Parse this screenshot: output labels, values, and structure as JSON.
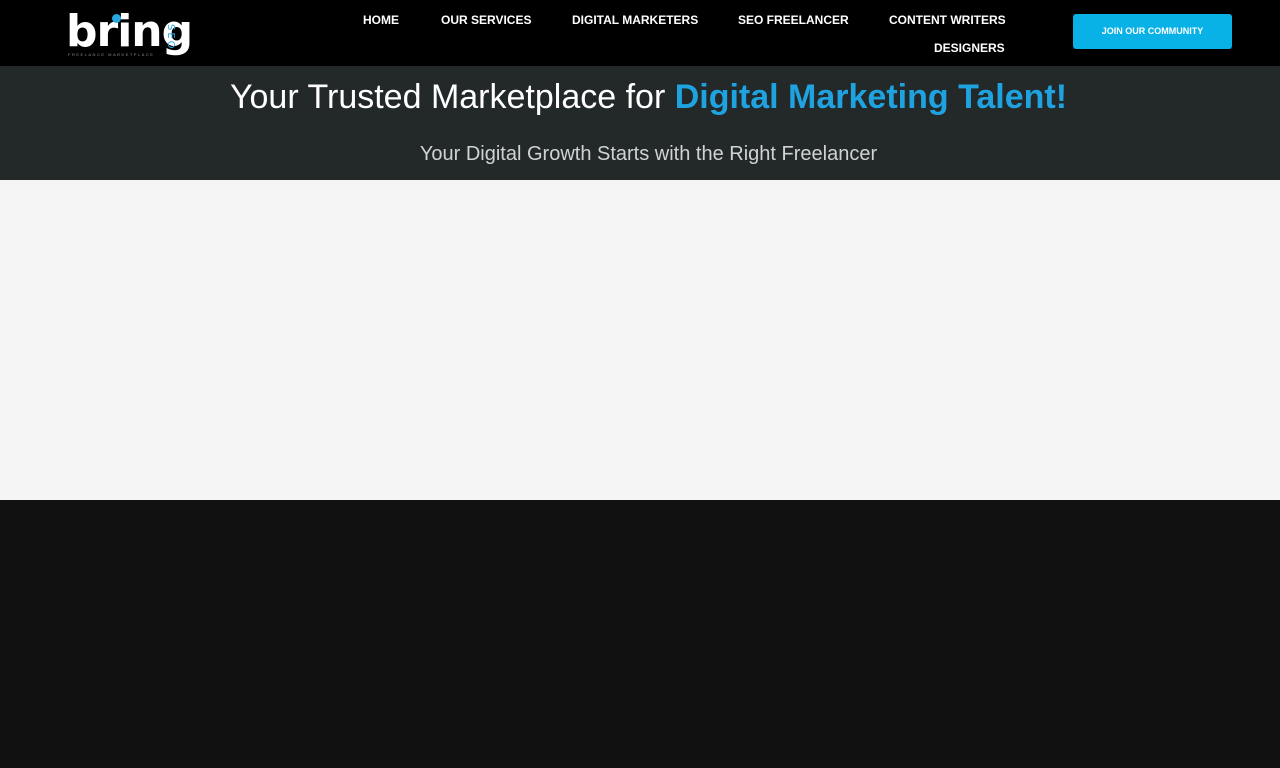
{
  "brand": {
    "logo_word": "bring",
    "logo_suffix": "SEO",
    "logo_tagline": "FREELANCE MARKETPLACE",
    "accent_color": "#1fa3e0"
  },
  "nav": {
    "items": [
      {
        "label": "HOME"
      },
      {
        "label": "OUR SERVICES"
      },
      {
        "label": "DIGITAL MARKETERS"
      },
      {
        "label": "SEO FREELANCER"
      },
      {
        "label": "CONTENT WRITERS"
      },
      {
        "label": "DESIGNERS"
      }
    ],
    "cta_label": "JOIN OUR COMMUNITY",
    "cta_color": "#08b2e6"
  },
  "hero": {
    "title_prefix": "Your Trusted Marketplace for ",
    "title_accent": "Digital Marketing Talent!",
    "subtitle": "Your Digital Growth Starts with the Right Freelancer",
    "background_color": "#232829"
  }
}
